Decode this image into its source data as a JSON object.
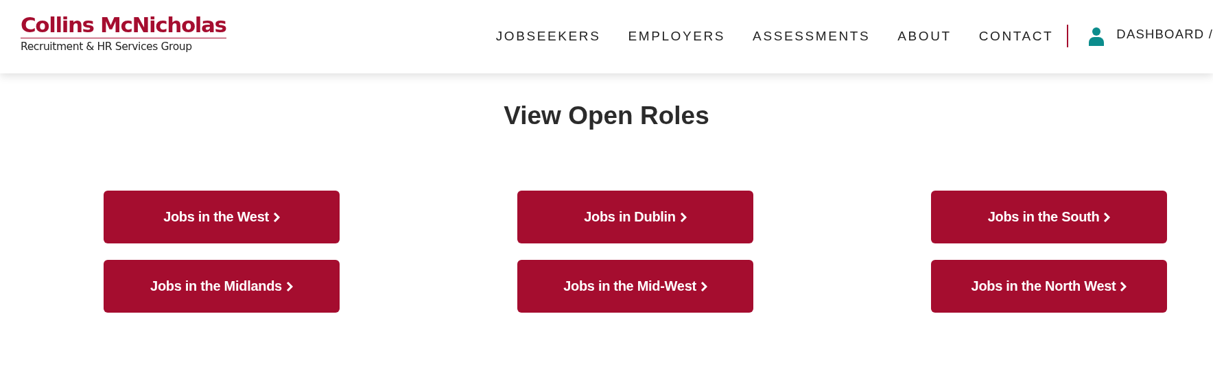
{
  "header": {
    "logo": {
      "name": "Collins McNicholas",
      "tagline": "Recruitment & HR Services Group"
    },
    "nav": [
      {
        "label": "JOBSEEKERS"
      },
      {
        "label": "EMPLOYERS"
      },
      {
        "label": "ASSESSMENTS"
      },
      {
        "label": "ABOUT"
      },
      {
        "label": "CONTACT"
      }
    ],
    "account": {
      "label": "DASHBOARD /"
    }
  },
  "title": "View Open Roles",
  "role_buttons": [
    {
      "label": "Jobs in the West"
    },
    {
      "label": "Jobs in Dublin"
    },
    {
      "label": "Jobs in the South"
    },
    {
      "label": "Jobs in the Midlands"
    },
    {
      "label": "Jobs in the Mid-West"
    },
    {
      "label": "Jobs in the North West"
    }
  ]
}
